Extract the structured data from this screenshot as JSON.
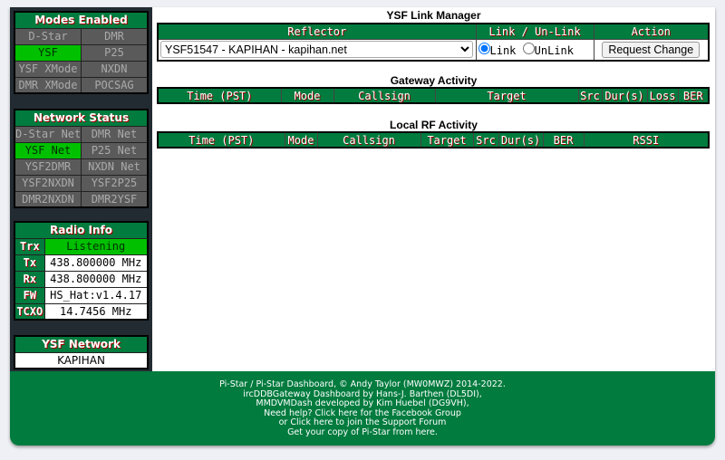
{
  "modes": {
    "title": "Modes Enabled",
    "items": [
      {
        "label": "D-Star",
        "active": false
      },
      {
        "label": "DMR",
        "active": false
      },
      {
        "label": "YSF",
        "active": true
      },
      {
        "label": "P25",
        "active": false
      },
      {
        "label": "YSF XMode",
        "active": false
      },
      {
        "label": "NXDN",
        "active": false
      },
      {
        "label": "DMR XMode",
        "active": false
      },
      {
        "label": "POCSAG",
        "active": false
      }
    ]
  },
  "network": {
    "title": "Network Status",
    "items": [
      {
        "label": "D-Star Net",
        "active": false
      },
      {
        "label": "DMR Net",
        "active": false
      },
      {
        "label": "YSF Net",
        "active": true
      },
      {
        "label": "P25 Net",
        "active": false
      },
      {
        "label": "YSF2DMR",
        "active": false
      },
      {
        "label": "NXDN Net",
        "active": false
      },
      {
        "label": "YSF2NXDN",
        "active": false
      },
      {
        "label": "YSF2P25",
        "active": false
      },
      {
        "label": "DMR2NXDN",
        "active": false
      },
      {
        "label": "DMR2YSF",
        "active": false
      }
    ]
  },
  "radio": {
    "title": "Radio Info",
    "rows": [
      {
        "label": "Trx",
        "value": "Listening"
      },
      {
        "label": "Tx",
        "value": "438.800000 MHz"
      },
      {
        "label": "Rx",
        "value": "438.800000 MHz"
      },
      {
        "label": "FW",
        "value": "HS_Hat:v1.4.17"
      },
      {
        "label": "TCXO",
        "value": "14.7456 MHz"
      }
    ]
  },
  "ysf_network": {
    "title": "YSF Network",
    "value": "KAPIHAN"
  },
  "link_manager": {
    "title": "YSF Link Manager",
    "headers": [
      "Reflector",
      "Link / Un-Link",
      "Action"
    ],
    "reflector": "YSF51547 - KAPIHAN - kapihan.net",
    "link_label": "Link",
    "unlink_label": "UnLink",
    "selected": "Link",
    "button": "Request Change"
  },
  "gateway": {
    "title": "Gateway Activity",
    "headers": [
      "Time (PST)",
      "Mode",
      "Callsign",
      "Target",
      "Src",
      "Dur(s)",
      "Loss",
      "BER"
    ]
  },
  "local_rf": {
    "title": "Local RF Activity",
    "headers": [
      "Time (PST)",
      "Mode",
      "Callsign",
      "Target",
      "Src",
      "Dur(s)",
      "BER",
      "RSSI"
    ]
  },
  "footer": {
    "lines": [
      "Pi-Star / Pi-Star Dashboard, © Andy Taylor (MW0MWZ) 2014-2022.",
      "ircDDBGateway Dashboard by Hans-J. Barthen (DL5DI),",
      "MMDVMDash developed by Kim Huebel (DG9VH),",
      "Need help? Click here for the Facebook Group",
      "or Click here to join the Support Forum",
      "Get your copy of Pi-Star from here."
    ]
  },
  "colors": {
    "green": "#017b3e",
    "active": "#00c000",
    "inactive": "#5a5a5a",
    "sidebar": "#232b32"
  }
}
